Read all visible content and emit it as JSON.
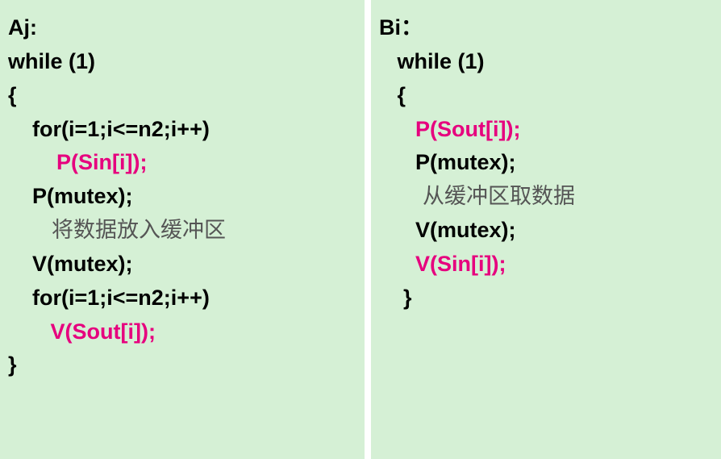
{
  "left": {
    "title": "Aj:",
    "l1": "while (1)",
    "l2": "{",
    "l3": "    for(i=1;i<=n2;i++)",
    "l4": "        P(Sin[i]);",
    "l5": "    P(mutex);",
    "c1": "        将数据放入缓冲区",
    "l6": "    V(mutex);",
    "l7": "    for(i=1;i<=n2;i++)",
    "l8": "       V(Sout[i]);",
    "l9": "}"
  },
  "right": {
    "title": "Bi：",
    "l1": "   while (1)",
    "l2": "   {",
    "l3": "      P(Sout[i]);",
    "l4": "      P(mutex);",
    "c1": "        从缓冲区取数据",
    "l5": "      V(mutex);",
    "l6": "      V(Sin[i]);",
    "l7": "    }"
  }
}
